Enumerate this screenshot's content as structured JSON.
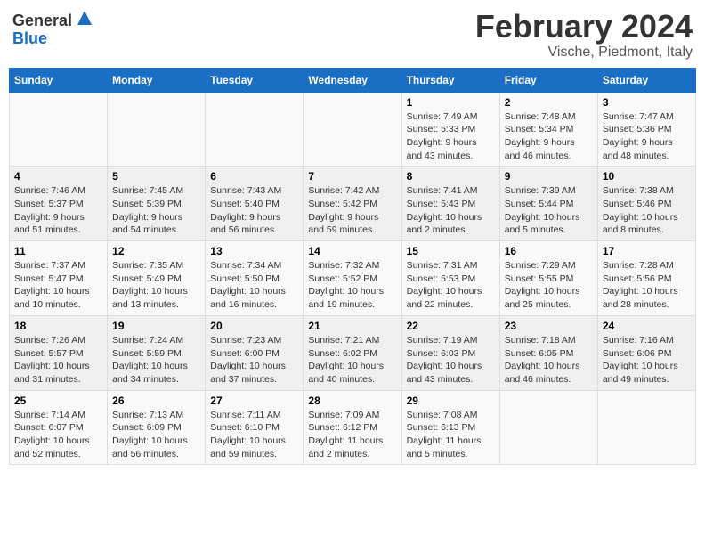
{
  "logo": {
    "general": "General",
    "blue": "Blue"
  },
  "title": "February 2024",
  "subtitle": "Vische, Piedmont, Italy",
  "days_header": [
    "Sunday",
    "Monday",
    "Tuesday",
    "Wednesday",
    "Thursday",
    "Friday",
    "Saturday"
  ],
  "weeks": [
    [
      {
        "day": "",
        "info": ""
      },
      {
        "day": "",
        "info": ""
      },
      {
        "day": "",
        "info": ""
      },
      {
        "day": "",
        "info": ""
      },
      {
        "day": "1",
        "info": "Sunrise: 7:49 AM\nSunset: 5:33 PM\nDaylight: 9 hours\nand 43 minutes."
      },
      {
        "day": "2",
        "info": "Sunrise: 7:48 AM\nSunset: 5:34 PM\nDaylight: 9 hours\nand 46 minutes."
      },
      {
        "day": "3",
        "info": "Sunrise: 7:47 AM\nSunset: 5:36 PM\nDaylight: 9 hours\nand 48 minutes."
      }
    ],
    [
      {
        "day": "4",
        "info": "Sunrise: 7:46 AM\nSunset: 5:37 PM\nDaylight: 9 hours\nand 51 minutes."
      },
      {
        "day": "5",
        "info": "Sunrise: 7:45 AM\nSunset: 5:39 PM\nDaylight: 9 hours\nand 54 minutes."
      },
      {
        "day": "6",
        "info": "Sunrise: 7:43 AM\nSunset: 5:40 PM\nDaylight: 9 hours\nand 56 minutes."
      },
      {
        "day": "7",
        "info": "Sunrise: 7:42 AM\nSunset: 5:42 PM\nDaylight: 9 hours\nand 59 minutes."
      },
      {
        "day": "8",
        "info": "Sunrise: 7:41 AM\nSunset: 5:43 PM\nDaylight: 10 hours\nand 2 minutes."
      },
      {
        "day": "9",
        "info": "Sunrise: 7:39 AM\nSunset: 5:44 PM\nDaylight: 10 hours\nand 5 minutes."
      },
      {
        "day": "10",
        "info": "Sunrise: 7:38 AM\nSunset: 5:46 PM\nDaylight: 10 hours\nand 8 minutes."
      }
    ],
    [
      {
        "day": "11",
        "info": "Sunrise: 7:37 AM\nSunset: 5:47 PM\nDaylight: 10 hours\nand 10 minutes."
      },
      {
        "day": "12",
        "info": "Sunrise: 7:35 AM\nSunset: 5:49 PM\nDaylight: 10 hours\nand 13 minutes."
      },
      {
        "day": "13",
        "info": "Sunrise: 7:34 AM\nSunset: 5:50 PM\nDaylight: 10 hours\nand 16 minutes."
      },
      {
        "day": "14",
        "info": "Sunrise: 7:32 AM\nSunset: 5:52 PM\nDaylight: 10 hours\nand 19 minutes."
      },
      {
        "day": "15",
        "info": "Sunrise: 7:31 AM\nSunset: 5:53 PM\nDaylight: 10 hours\nand 22 minutes."
      },
      {
        "day": "16",
        "info": "Sunrise: 7:29 AM\nSunset: 5:55 PM\nDaylight: 10 hours\nand 25 minutes."
      },
      {
        "day": "17",
        "info": "Sunrise: 7:28 AM\nSunset: 5:56 PM\nDaylight: 10 hours\nand 28 minutes."
      }
    ],
    [
      {
        "day": "18",
        "info": "Sunrise: 7:26 AM\nSunset: 5:57 PM\nDaylight: 10 hours\nand 31 minutes."
      },
      {
        "day": "19",
        "info": "Sunrise: 7:24 AM\nSunset: 5:59 PM\nDaylight: 10 hours\nand 34 minutes."
      },
      {
        "day": "20",
        "info": "Sunrise: 7:23 AM\nSunset: 6:00 PM\nDaylight: 10 hours\nand 37 minutes."
      },
      {
        "day": "21",
        "info": "Sunrise: 7:21 AM\nSunset: 6:02 PM\nDaylight: 10 hours\nand 40 minutes."
      },
      {
        "day": "22",
        "info": "Sunrise: 7:19 AM\nSunset: 6:03 PM\nDaylight: 10 hours\nand 43 minutes."
      },
      {
        "day": "23",
        "info": "Sunrise: 7:18 AM\nSunset: 6:05 PM\nDaylight: 10 hours\nand 46 minutes."
      },
      {
        "day": "24",
        "info": "Sunrise: 7:16 AM\nSunset: 6:06 PM\nDaylight: 10 hours\nand 49 minutes."
      }
    ],
    [
      {
        "day": "25",
        "info": "Sunrise: 7:14 AM\nSunset: 6:07 PM\nDaylight: 10 hours\nand 52 minutes."
      },
      {
        "day": "26",
        "info": "Sunrise: 7:13 AM\nSunset: 6:09 PM\nDaylight: 10 hours\nand 56 minutes."
      },
      {
        "day": "27",
        "info": "Sunrise: 7:11 AM\nSunset: 6:10 PM\nDaylight: 10 hours\nand 59 minutes."
      },
      {
        "day": "28",
        "info": "Sunrise: 7:09 AM\nSunset: 6:12 PM\nDaylight: 11 hours\nand 2 minutes."
      },
      {
        "day": "29",
        "info": "Sunrise: 7:08 AM\nSunset: 6:13 PM\nDaylight: 11 hours\nand 5 minutes."
      },
      {
        "day": "",
        "info": ""
      },
      {
        "day": "",
        "info": ""
      }
    ]
  ]
}
